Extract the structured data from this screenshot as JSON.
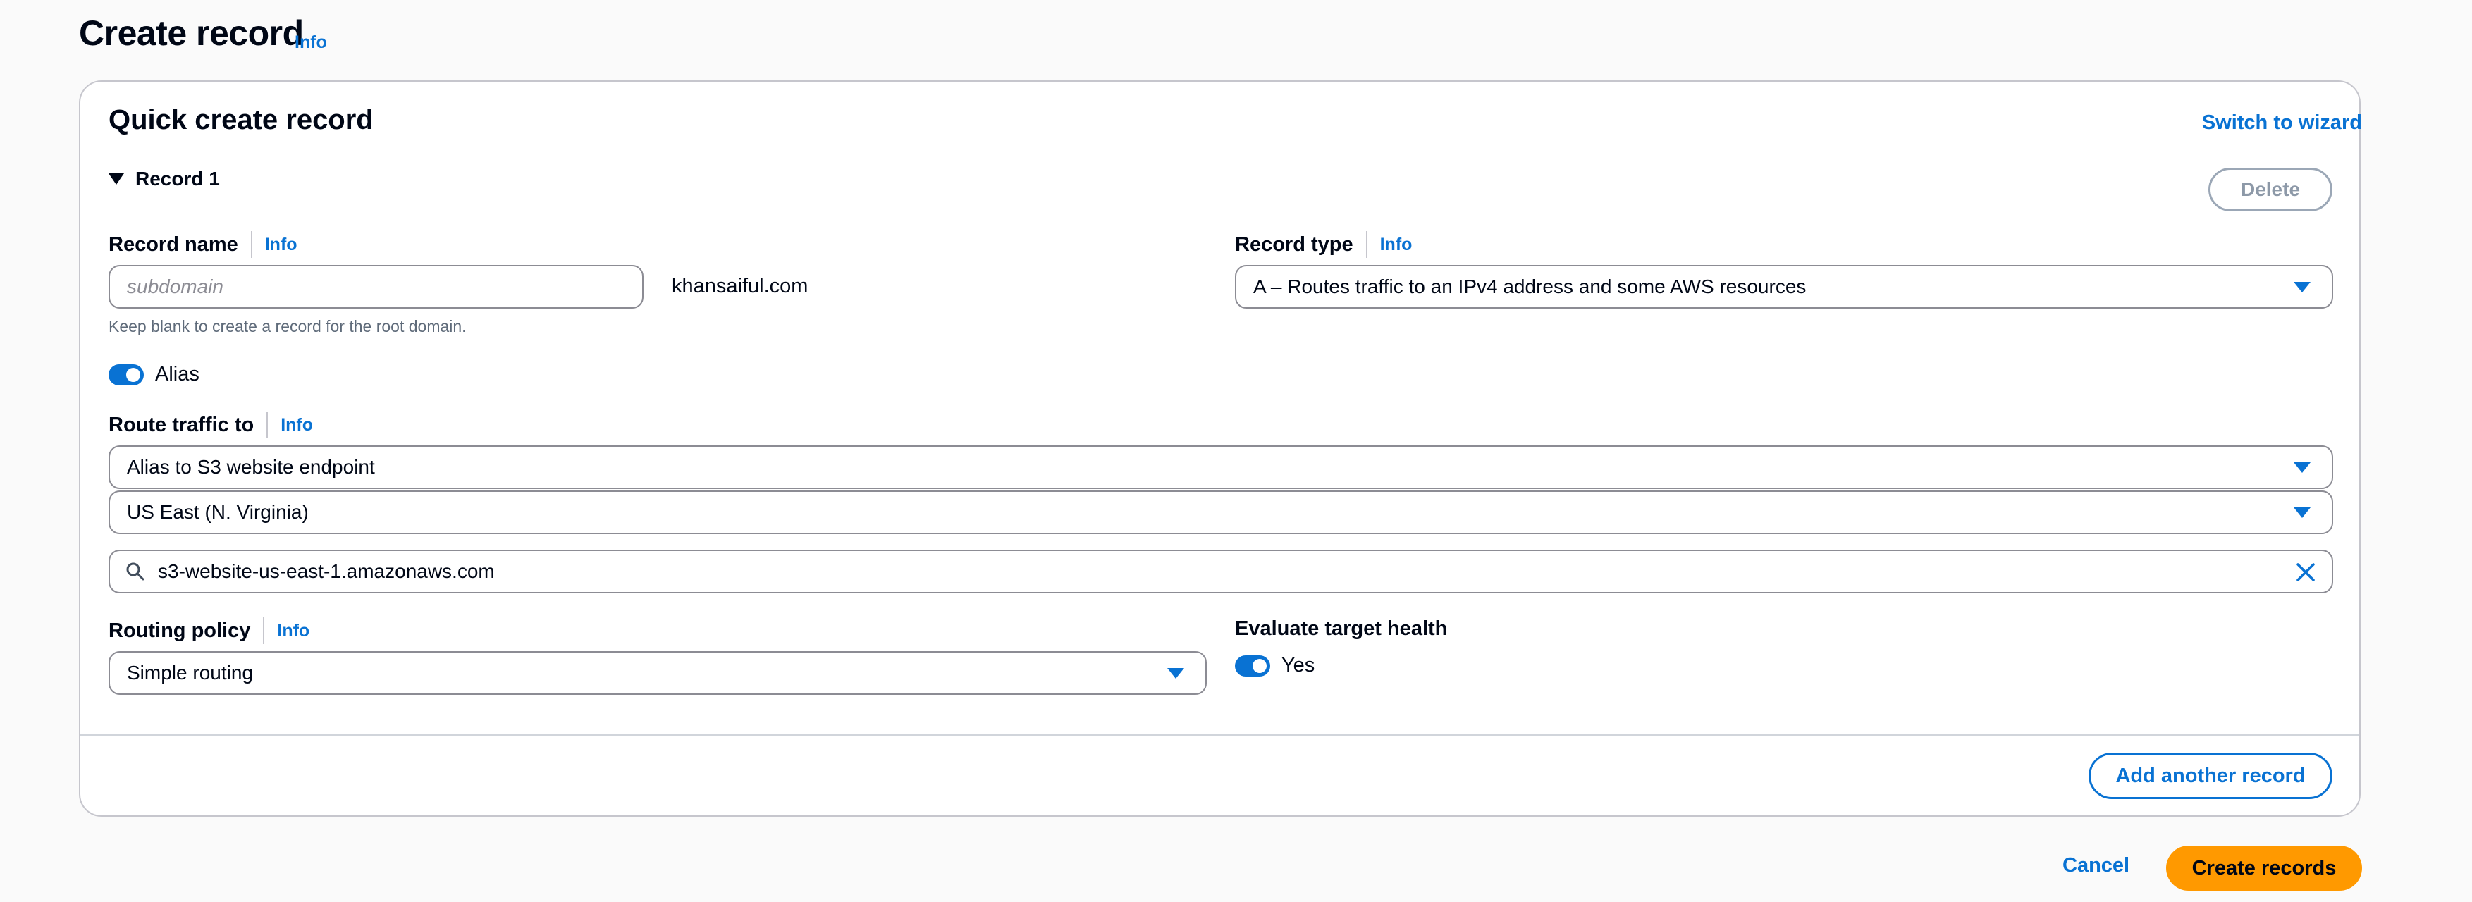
{
  "header": {
    "title": "Create record",
    "info": "Info"
  },
  "card": {
    "title": "Quick create record",
    "switch_link": "Switch to wizard",
    "record_label": "Record 1",
    "delete_label": "Delete"
  },
  "record_name": {
    "label": "Record name",
    "info": "Info",
    "placeholder": "subdomain",
    "value": "",
    "domain_suffix": "khansaiful.com",
    "hint": "Keep blank to create a record for the root domain."
  },
  "record_type": {
    "label": "Record type",
    "info": "Info",
    "value": "A – Routes traffic to an IPv4 address and some AWS resources"
  },
  "alias": {
    "label": "Alias",
    "enabled": true
  },
  "route_traffic": {
    "label": "Route traffic to",
    "info": "Info",
    "endpoint_type": "Alias to S3 website endpoint",
    "region": "US East (N. Virginia)",
    "endpoint_value": "s3-website-us-east-1.amazonaws.com"
  },
  "routing_policy": {
    "label": "Routing policy",
    "info": "Info",
    "value": "Simple routing"
  },
  "evaluate_health": {
    "label": "Evaluate target health",
    "toggle_label": "Yes",
    "enabled": true
  },
  "actions": {
    "add_another": "Add another record",
    "cancel": "Cancel",
    "create": "Create records"
  },
  "colors": {
    "accent": "#0972d3",
    "primary_button": "#ff9900",
    "border": "#c6c6cd"
  },
  "icons": {
    "expander": "caret-down-icon",
    "search": "search-icon",
    "clear": "close-icon",
    "dropdown": "chevron-down-icon"
  }
}
